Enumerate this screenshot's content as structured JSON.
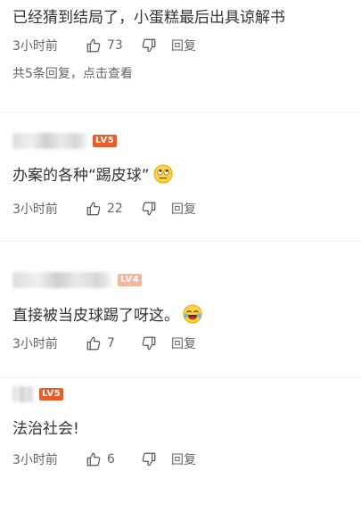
{
  "comments": [
    {
      "text": "已经猜到结局了，小蛋糕最后出具谅解书",
      "time": "3小时前",
      "likes": "73",
      "reply_label": "回复",
      "replies_link": "共5条回复，点击查看"
    },
    {
      "level": "LV5",
      "text": "办案的各种“踢皮球”",
      "emoji": "rolling-eyes-emoji",
      "time": "3小时前",
      "likes": "22",
      "reply_label": "回复"
    },
    {
      "level": "LV4",
      "text": "直接被当皮球踢了呀这。",
      "emoji": "laughing-tears-emoji",
      "time": "3小时前",
      "likes": "7",
      "reply_label": "回复"
    },
    {
      "level": "LV5",
      "text": "法治社会!",
      "time": "3小时前",
      "likes": "6",
      "reply_label": "回复"
    }
  ],
  "colors": {
    "text": "#333333",
    "meta": "#666666",
    "level_badge": "#e95b2b",
    "level_badge_faded": "#f3b59e"
  }
}
